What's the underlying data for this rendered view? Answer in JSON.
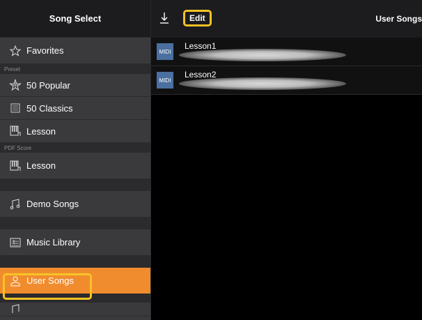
{
  "sidebar": {
    "title": "Song Select",
    "favorites": "Favorites",
    "section_preset": "Preset",
    "popular": "50 Popular",
    "classics": "50 Classics",
    "lesson_preset": "Lesson",
    "section_pdf": "PDF Score",
    "lesson_pdf": "Lesson",
    "demo_songs": "Demo Songs",
    "music_library": "Music Library",
    "user_songs": "User Songs"
  },
  "toolbar": {
    "edit_label": "Edit",
    "title": "User Songs"
  },
  "songs": [
    {
      "badge": "MIDI",
      "name": "Lesson1"
    },
    {
      "badge": "MIDI",
      "name": "Lesson2"
    }
  ],
  "colors": {
    "accent_active": "#f08c2e",
    "highlight": "#f7c325",
    "midi_badge": "#4a6fa0",
    "sidebar_bg": "#3a3a3c"
  }
}
